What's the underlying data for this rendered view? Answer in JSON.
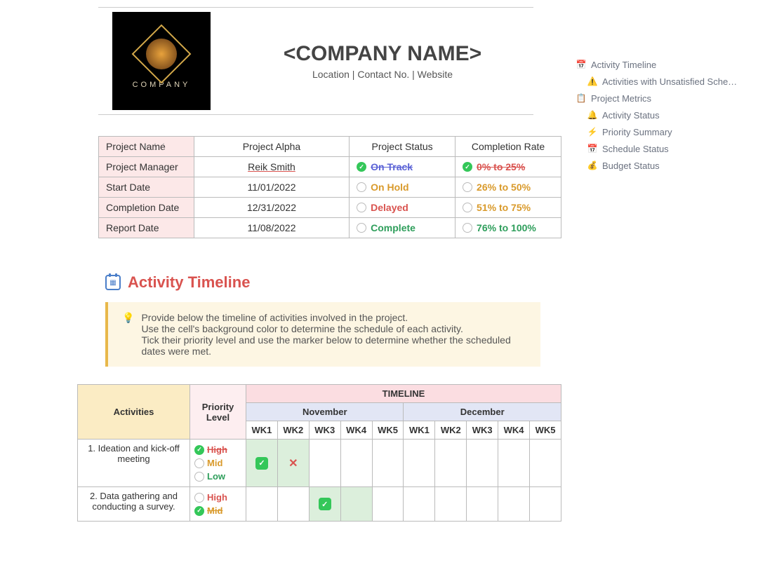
{
  "header": {
    "logo_text": "COMPANY",
    "title": "<COMPANY NAME>",
    "subtitle": "Location | Contact No. | Website"
  },
  "sidebar": [
    {
      "icon": "📅",
      "label": "Activity Timeline",
      "sub": false
    },
    {
      "icon": "⚠️",
      "label": "Activities with Unsatisfied Sche…",
      "sub": true
    },
    {
      "icon": "📋",
      "label": "Project Metrics",
      "sub": false
    },
    {
      "icon": "🔔",
      "label": "Activity Status",
      "sub": true
    },
    {
      "icon": "⚡",
      "label": "Priority Summary",
      "sub": true
    },
    {
      "icon": "📅",
      "label": "Schedule Status",
      "sub": true
    },
    {
      "icon": "💰",
      "label": "Budget Status",
      "sub": true
    }
  ],
  "info": {
    "rows": [
      {
        "label": "Project Name",
        "value": "Project Alpha"
      },
      {
        "label": "Project Manager",
        "value": "Reik Smith"
      },
      {
        "label": "Start Date",
        "value": "11/01/2022"
      },
      {
        "label": "Completion Date",
        "value": "12/31/2022"
      },
      {
        "label": "Report Date",
        "value": "11/08/2022"
      }
    ],
    "status_header": "Project Status",
    "rate_header": "Completion Rate",
    "status": [
      {
        "label": "On Track",
        "color": "#5b63d6",
        "checked": true,
        "strike": true
      },
      {
        "label": "On Hold",
        "color": "#d99a2b",
        "checked": false,
        "strike": false
      },
      {
        "label": "Delayed",
        "color": "#d9534f",
        "checked": false,
        "strike": false
      },
      {
        "label": "Complete",
        "color": "#2e9e5b",
        "checked": false,
        "strike": false
      }
    ],
    "rate": [
      {
        "label": "0% to 25%",
        "color": "#d9534f",
        "checked": true,
        "strike": true
      },
      {
        "label": "26% to 50%",
        "color": "#d99a2b",
        "checked": false,
        "strike": false
      },
      {
        "label": "51% to 75%",
        "color": "#d99a2b",
        "checked": false,
        "strike": false
      },
      {
        "label": "76% to 100%",
        "color": "#2e9e5b",
        "checked": false,
        "strike": false
      }
    ]
  },
  "section": {
    "title": "Activity Timeline",
    "callout_lines": [
      "Provide below the timeline of activities involved in the project.",
      "Use the cell's background color to determine the schedule of each activity.",
      "Tick their priority level and use the marker below to determine whether the scheduled dates were met."
    ]
  },
  "timeline": {
    "head": {
      "activities": "Activities",
      "priority": "Priority Level",
      "timeline": "TIMELINE",
      "months": [
        "November",
        "December"
      ],
      "weeks": [
        "WK1",
        "WK2",
        "WK3",
        "WK4",
        "WK5",
        "WK1",
        "WK2",
        "WK3",
        "WK4",
        "WK5"
      ]
    },
    "rows": [
      {
        "activity": "1. Ideation and kick-off meeting",
        "priority": [
          {
            "label": "High",
            "color": "#d9534f",
            "checked": true,
            "strike": true
          },
          {
            "label": "Mid",
            "color": "#d99a2b",
            "checked": false,
            "strike": false
          },
          {
            "label": "Low",
            "color": "#2e9e5b",
            "checked": false,
            "strike": false
          }
        ],
        "cells": [
          {
            "bg": "green",
            "mark": "check"
          },
          {
            "bg": "green",
            "mark": "x"
          },
          {
            "bg": "",
            "mark": ""
          },
          {
            "bg": "",
            "mark": ""
          },
          {
            "bg": "",
            "mark": ""
          },
          {
            "bg": "",
            "mark": ""
          },
          {
            "bg": "",
            "mark": ""
          },
          {
            "bg": "",
            "mark": ""
          },
          {
            "bg": "",
            "mark": ""
          },
          {
            "bg": "",
            "mark": ""
          }
        ]
      },
      {
        "activity": "2. Data gathering and conducting a survey.",
        "priority": [
          {
            "label": "High",
            "color": "#d9534f",
            "checked": false,
            "strike": false
          },
          {
            "label": "Mid",
            "color": "#d99a2b",
            "checked": true,
            "strike": true
          }
        ],
        "cells": [
          {
            "bg": "",
            "mark": ""
          },
          {
            "bg": "",
            "mark": ""
          },
          {
            "bg": "green",
            "mark": "check"
          },
          {
            "bg": "green",
            "mark": ""
          },
          {
            "bg": "",
            "mark": ""
          },
          {
            "bg": "",
            "mark": ""
          },
          {
            "bg": "",
            "mark": ""
          },
          {
            "bg": "",
            "mark": ""
          },
          {
            "bg": "",
            "mark": ""
          },
          {
            "bg": "",
            "mark": ""
          }
        ]
      }
    ]
  }
}
